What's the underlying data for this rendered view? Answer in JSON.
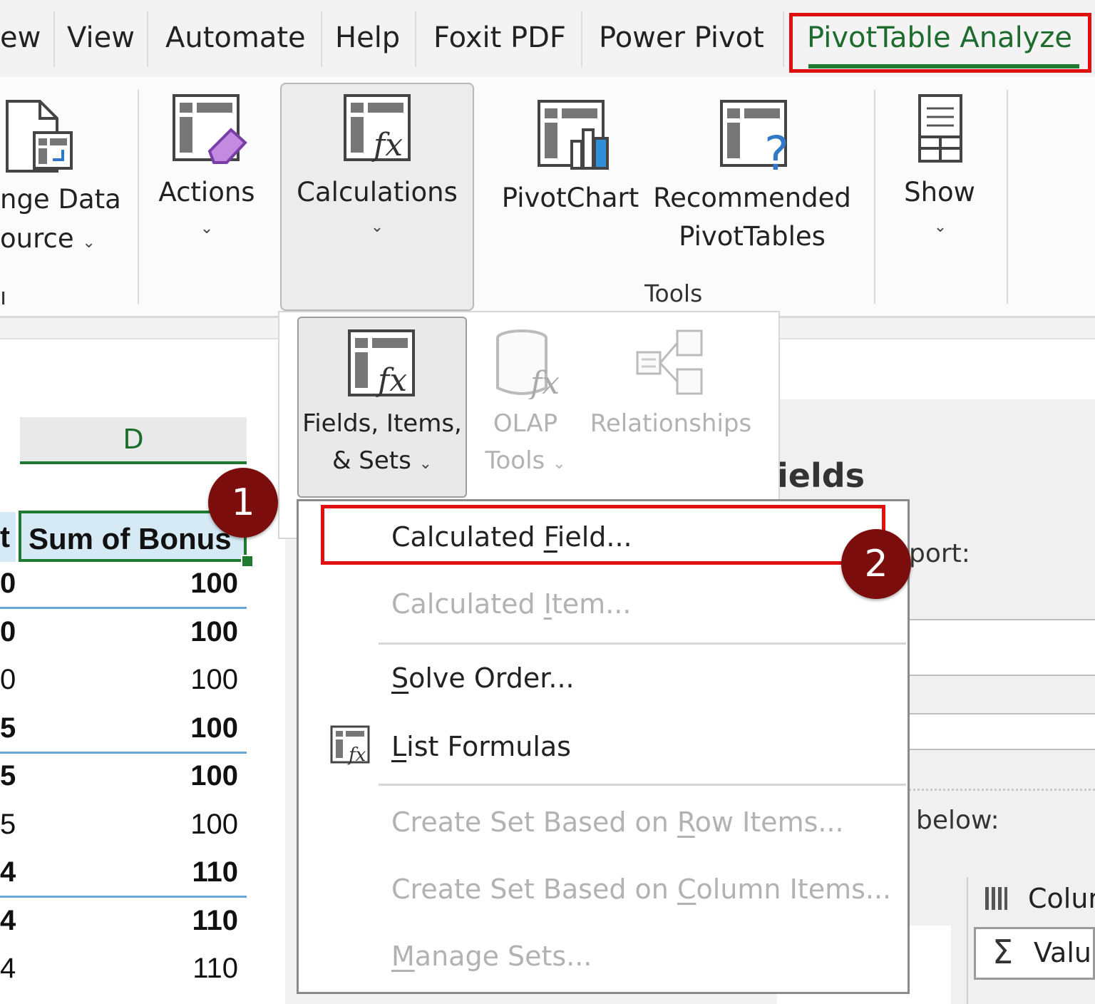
{
  "tabs": [
    {
      "label": "ew"
    },
    {
      "label": "View"
    },
    {
      "label": "Automate"
    },
    {
      "label": "Help"
    },
    {
      "label": "Foxit PDF"
    },
    {
      "label": "Power Pivot"
    },
    {
      "label": "PivotTable Analyze",
      "active": true
    }
  ],
  "ribbon": {
    "change_data_line1": "nge Data",
    "change_data_line2": "ource",
    "change_data_chevron": "⌄",
    "actions_label": "Actions",
    "actions_chevron": "⌄",
    "calculations_label": "Calculations",
    "calculations_chevron": "⌄",
    "pivotchart_label": "PivotChart",
    "recommended_line1": "Recommended",
    "recommended_line2": "PivotTables",
    "tools_group_label": "Tools",
    "show_label": "Show",
    "show_chevron": "⌄",
    "left_group_fragment": "ı"
  },
  "submenu": {
    "fields_line1": "Fields, Items,",
    "fields_line2": "& Sets",
    "fields_chevron": "⌄",
    "olap_line1": "OLAP",
    "olap_line2": "Tools",
    "olap_chevron": "⌄",
    "relationships_label": "Relationships"
  },
  "dropdown": {
    "items": [
      {
        "pre": "Calculated ",
        "u": "F",
        "post": "ield...",
        "enabled": true
      },
      {
        "pre": "Calculated ",
        "u": "I",
        "post": "tem...",
        "enabled": false
      },
      {
        "pre": "",
        "u": "S",
        "post": "olve Order...",
        "enabled": true
      },
      {
        "pre": "",
        "u": "L",
        "post": "ist Formulas",
        "enabled": true
      },
      {
        "pre": "Create Set Based on ",
        "u": "R",
        "post": "ow Items...",
        "enabled": false
      },
      {
        "pre": "Create Set Based on ",
        "u": "C",
        "post": "olumn Items...",
        "enabled": false
      },
      {
        "pre": "",
        "u": "M",
        "post": "anage Sets...",
        "enabled": false
      }
    ]
  },
  "sheet": {
    "column_header": "D",
    "header_left_fragment": "t",
    "header_cell": "Sum of Bonus",
    "rows": [
      {
        "left": "0",
        "value": "100",
        "bold": true
      },
      {
        "left": "0",
        "value": "100",
        "bold": true
      },
      {
        "left": "0",
        "value": "100",
        "bold": false
      },
      {
        "left": "5",
        "value": "100",
        "bold": true
      },
      {
        "left": "5",
        "value": "100",
        "bold": true
      },
      {
        "left": "5",
        "value": "100",
        "bold": false
      },
      {
        "left": "4",
        "value": "110",
        "bold": true
      },
      {
        "left": "4",
        "value": "110",
        "bold": true
      },
      {
        "left": "4",
        "value": "110",
        "bold": false
      }
    ]
  },
  "right_pane": {
    "title_fragment": "ields",
    "report_fragment": "port:",
    "below_fragment": "below:",
    "columns_fragment": "Colur",
    "values_fragment": "Valu",
    "sigma": "Σ"
  },
  "badges": {
    "one": "1",
    "two": "2"
  },
  "colors": {
    "accent_green": "#1d7a2f",
    "highlight_red": "#e01010",
    "badge": "#7b0d0d",
    "header_fill": "#d6eaf6"
  }
}
